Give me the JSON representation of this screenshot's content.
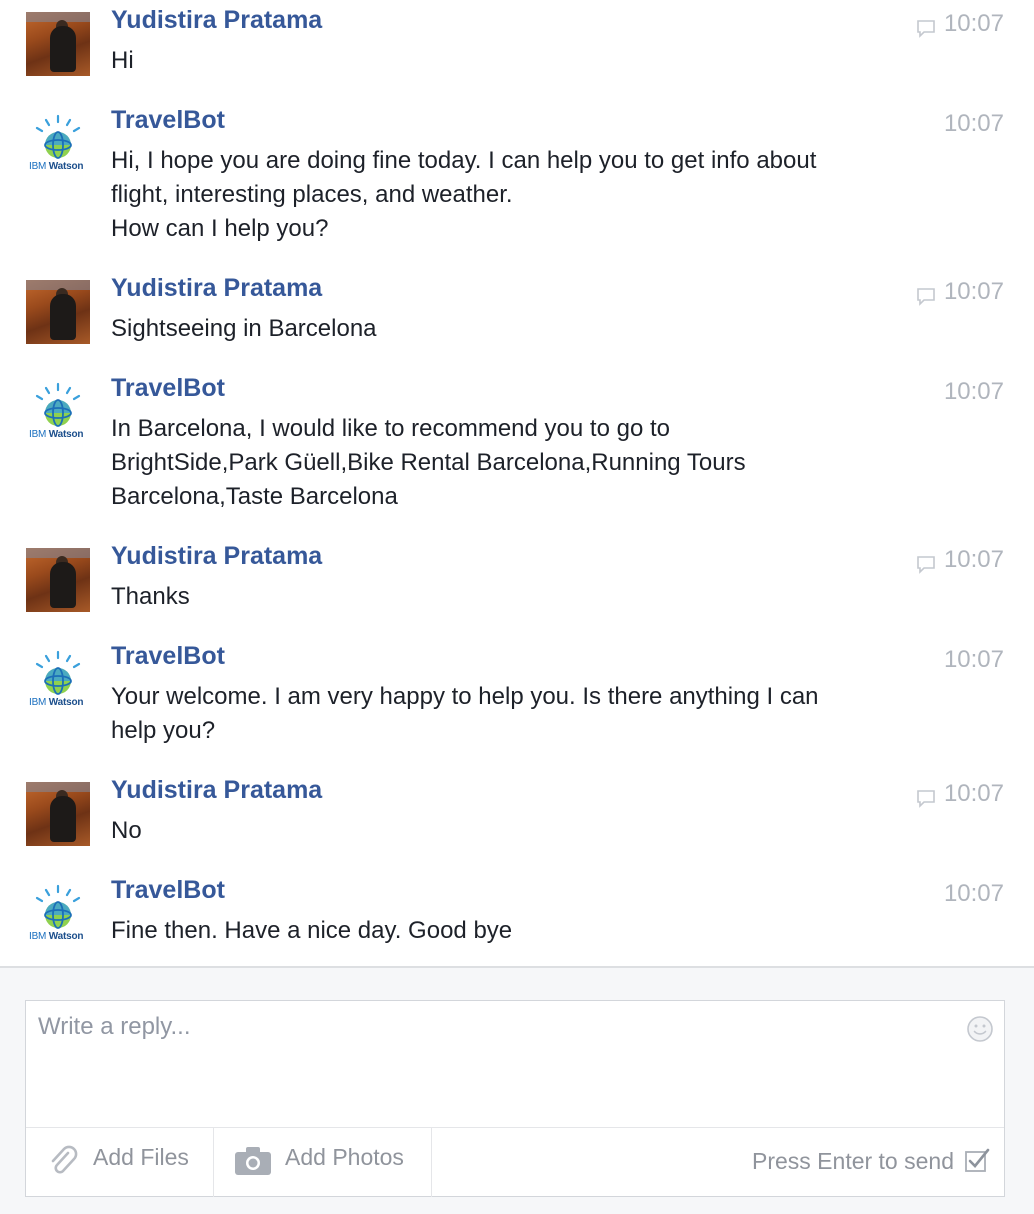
{
  "messages": [
    {
      "sender": "Yudistira Pratama",
      "avatar": "user-photo",
      "time": "10:07",
      "seen": true,
      "lines": [
        "Hi"
      ]
    },
    {
      "sender": "TravelBot",
      "avatar": "ibm-watson-logo",
      "time": "10:07",
      "seen": false,
      "lines": [
        "Hi, I hope you are doing fine today. I can help you to get info about",
        "flight, interesting places, and weather.",
        "How can I help you?"
      ]
    },
    {
      "sender": "Yudistira Pratama",
      "avatar": "user-photo",
      "time": "10:07",
      "seen": true,
      "lines": [
        "Sightseeing in Barcelona"
      ]
    },
    {
      "sender": "TravelBot",
      "avatar": "ibm-watson-logo",
      "time": "10:07",
      "seen": false,
      "lines": [
        "In Barcelona, I would like to recommend you to go to",
        "BrightSide,Park Güell,Bike Rental Barcelona,Running Tours",
        "Barcelona,Taste Barcelona"
      ]
    },
    {
      "sender": "Yudistira Pratama",
      "avatar": "user-photo",
      "time": "10:07",
      "seen": true,
      "lines": [
        "Thanks"
      ]
    },
    {
      "sender": "TravelBot",
      "avatar": "ibm-watson-logo",
      "time": "10:07",
      "seen": false,
      "lines": [
        "Your welcome. I am very happy to help you. Is there anything I can",
        "help you?"
      ]
    },
    {
      "sender": "Yudistira Pratama",
      "avatar": "user-photo",
      "time": "10:07",
      "seen": true,
      "lines": [
        "No"
      ]
    },
    {
      "sender": "TravelBot",
      "avatar": "ibm-watson-logo",
      "time": "10:07",
      "seen": false,
      "lines": [
        "Fine then. Have a nice day. Good bye"
      ]
    }
  ],
  "watson_label": {
    "ibm": "IBM",
    "watson": "Watson"
  },
  "composer": {
    "placeholder": "Write a reply...",
    "add_files": "Add Files",
    "add_photos": "Add Photos",
    "send_hint": "Press Enter to send"
  },
  "colors": {
    "name": "#365899",
    "text": "#1d2129",
    "muted": "#90949c"
  }
}
